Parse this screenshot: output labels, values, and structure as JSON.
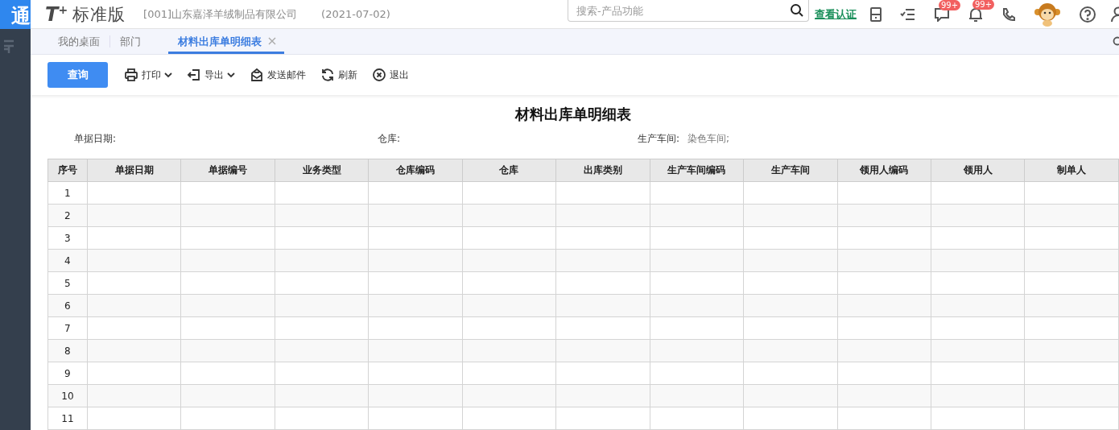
{
  "sidebar": {
    "logo_text": "通"
  },
  "header": {
    "brand_mark": "T$^{+}$",
    "brand_name": "标准版",
    "company": "[001]山东嘉泽羊绒制品有限公司",
    "date": "(2021-07-02)",
    "search": {
      "placeholder": "搜索-产品功能"
    },
    "link": "查看认证",
    "badges": [
      "99+",
      "99+"
    ]
  },
  "tabs": [
    {
      "label": "我的桌面",
      "selected": false,
      "closable": false
    },
    {
      "label": "部门",
      "selected": false,
      "closable": false
    },
    {
      "label": "材料出库单明细表",
      "selected": true,
      "closable": true
    }
  ],
  "toolbar": [
    {
      "kind": "primary",
      "label": "查询",
      "dropdown": false
    },
    {
      "kind": "print",
      "label": "打印",
      "dropdown": true
    },
    {
      "kind": "export",
      "label": "导出",
      "dropdown": true
    },
    {
      "kind": "mail",
      "label": "发送邮件",
      "dropdown": false
    },
    {
      "kind": "refresh",
      "label": "刷新",
      "dropdown": false
    },
    {
      "kind": "exit",
      "label": "退出",
      "dropdown": false
    }
  ],
  "report": {
    "title": "材料出库单明细表",
    "filters": [
      {
        "label": "单据日期:"
      },
      {
        "label": "仓库:"
      },
      {
        "label": "生产车间:",
        "value": "染色车间;"
      }
    ],
    "table": {
      "columns": [
        "序号",
        "单据日期",
        "单据编号",
        "业务类型",
        "仓库编码",
        "仓库",
        "出库类别",
        "生产车间编码",
        "生产车间",
        "领用人编码",
        "领用人",
        "制单人"
      ],
      "rows": [
        "1",
        "2",
        "3",
        "4",
        "5",
        "6",
        "7",
        "8",
        "9",
        "10",
        "11"
      ]
    }
  }
}
